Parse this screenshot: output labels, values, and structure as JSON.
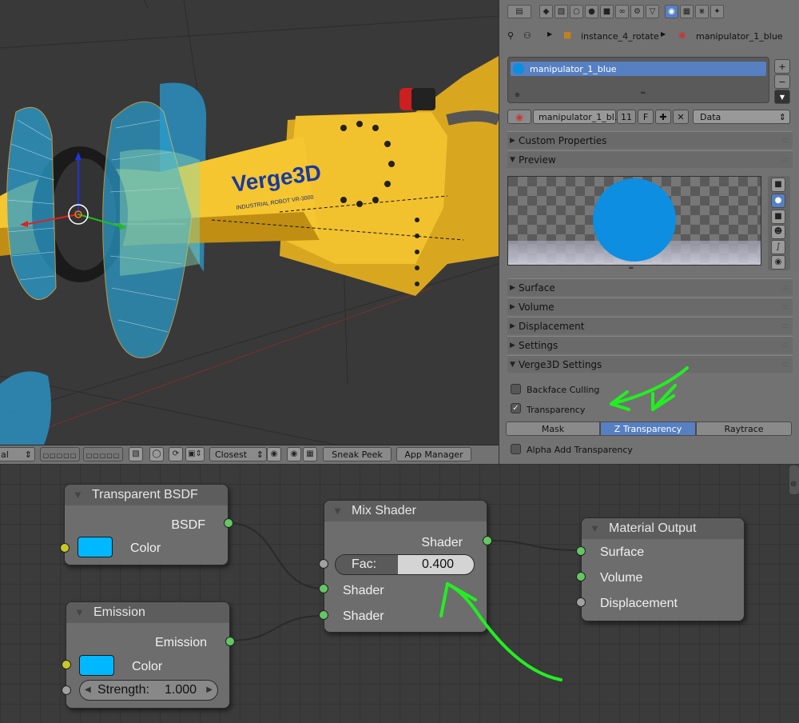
{
  "viewport": {
    "logo_text": "Verge3D",
    "logo_subtext": "INDUSTRIAL ROBOT VR-3000"
  },
  "viewport_header": {
    "mode_select": "al",
    "pivot_select": "Closest",
    "sneak_peek": "Sneak Peek",
    "app_manager": "App Manager"
  },
  "properties": {
    "breadcrumb_object": "instance_4_rotate",
    "breadcrumb_material": "manipulator_1_blue",
    "material_slot": "manipulator_1_blue",
    "material_name": "manipulator_1_bl...",
    "users_count": "11",
    "fake_user": "F",
    "link_select": "Data",
    "panels": {
      "custom_properties": "Custom Properties",
      "preview": "Preview",
      "surface": "Surface",
      "volume": "Volume",
      "displacement": "Displacement",
      "settings": "Settings",
      "verge3d_settings": "Verge3D Settings"
    },
    "backface_culling": "Backface Culling",
    "transparency": "Transparency",
    "blend_modes": [
      "Mask",
      "Z Transparency",
      "Raytrace"
    ],
    "alpha_add": "Alpha Add Transparency"
  },
  "nodes": {
    "transparent_bsdf": {
      "title": "Transparent BSDF",
      "output": "BSDF",
      "color_label": "Color"
    },
    "emission": {
      "title": "Emission",
      "output": "Emission",
      "color_label": "Color",
      "strength_label": "Strength:",
      "strength_value": "1.000"
    },
    "mix_shader": {
      "title": "Mix Shader",
      "output": "Shader",
      "fac_label": "Fac:",
      "fac_value": "0.400",
      "input1": "Shader",
      "input2": "Shader"
    },
    "material_output": {
      "title": "Material Output",
      "surface": "Surface",
      "volume": "Volume",
      "displacement": "Displacement"
    }
  },
  "colors": {
    "material_blue": "#0d8ee0",
    "node_color": "#00b8ff",
    "annotation_green": "#22ee22",
    "robot_yellow": "#f2c12e",
    "active_blue": "#5680c2"
  }
}
